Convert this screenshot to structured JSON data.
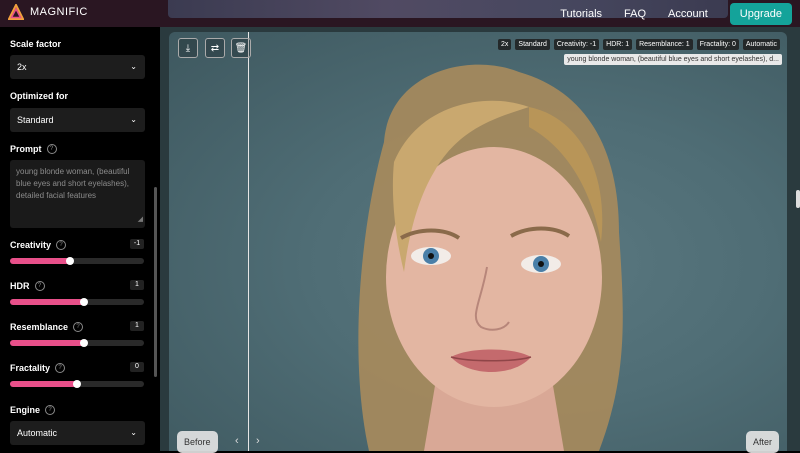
{
  "brand": {
    "name": "MAGNIFIC"
  },
  "nav": {
    "tutorials": "Tutorials",
    "faq": "FAQ",
    "account": "Account",
    "upgrade": "Upgrade"
  },
  "sidebar": {
    "scale_factor": {
      "label": "Scale factor",
      "value": "2x"
    },
    "optimized_for": {
      "label": "Optimized for",
      "value": "Standard"
    },
    "prompt": {
      "label": "Prompt",
      "value": "young blonde woman, (beautiful blue eyes and short eyelashes), detailed facial features"
    },
    "creativity": {
      "label": "Creativity",
      "value": "-1",
      "fill_fraction": 0.45
    },
    "hdr": {
      "label": "HDR",
      "value": "1",
      "fill_fraction": 0.55
    },
    "resemblance": {
      "label": "Resemblance",
      "value": "1",
      "fill_fraction": 0.55
    },
    "fractality": {
      "label": "Fractality",
      "value": "0",
      "fill_fraction": 0.5
    },
    "engine": {
      "label": "Engine",
      "value": "Automatic"
    }
  },
  "canvas": {
    "tags": [
      "2x",
      "Standard",
      "Creativity: -1",
      "HDR: 1",
      "Resemblance: 1",
      "Fractality: 0",
      "Automatic"
    ],
    "prompt_tag": "young blonde woman, (beautiful blue eyes and short eyelashes), d...",
    "before_label": "Before",
    "after_label": "After",
    "icons": [
      "download-icon",
      "swap-icon",
      "trash-icon"
    ]
  },
  "colors": {
    "accent": "#e8508a",
    "upgrade": "#14a39a",
    "topbar": "#2a1622"
  }
}
